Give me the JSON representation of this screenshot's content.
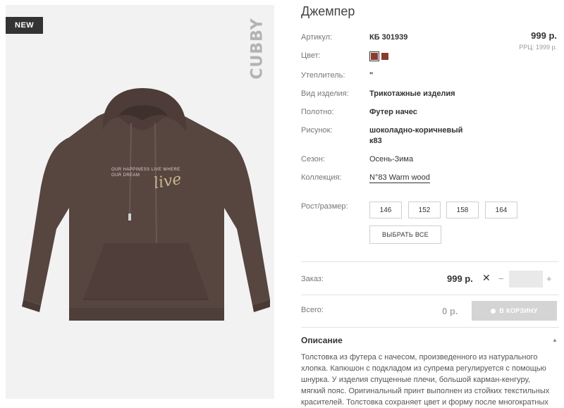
{
  "product": {
    "badge": "NEW",
    "brand": "CUBBY",
    "title": "Джемпер",
    "print_lines": [
      "OUR HAPPINESS LIVE WHERE",
      "OUR DREAM"
    ],
    "print_script": "live"
  },
  "attributes": {
    "article_label": "Артикул:",
    "article_value": "КБ 301939",
    "color_label": "Цвет:",
    "insulation_label": "Утеплитель:",
    "insulation_value": "\"",
    "type_label": "Вид изделия:",
    "type_value": "Трикотажные изделия",
    "fabric_label": "Полотно:",
    "fabric_value": "Футер начес",
    "pattern_label": "Рисунок:",
    "pattern_value_line1": "шоколадно-коричневый",
    "pattern_value_line2": "к83",
    "season_label": "Сезон:",
    "season_value": "Осень-Зима",
    "collection_label": "Коллекция:",
    "collection_value": "N°83 Warm wood",
    "size_label": "Рост/размер:"
  },
  "pricing": {
    "price": "999 р.",
    "rrp": "РРЦ: 1999 р."
  },
  "colors": [
    "#8a3a2e",
    "#8a3a2e"
  ],
  "sizes": [
    "146",
    "152",
    "158",
    "164"
  ],
  "select_all_label": "ВЫБРАТЬ ВСЕ",
  "order": {
    "order_label": "Заказ:",
    "order_price": "999 р.",
    "times": "✕",
    "minus": "−",
    "plus": "+",
    "qty_value": "",
    "total_label": "Всего:",
    "total_value": "0 р.",
    "cart_label": "В КОРЗИНУ"
  },
  "description": {
    "heading": "Описание",
    "text": "Толстовка из футера с начесом, произведенного из натурального хлопка. Капюшон с подкладом из супрема регулируется с помощью шнурка. У изделия спущенные плечи, большой карман-кенгуру, мягкий пояс. Оригинальный принт выполнен из стойких текстильных красителей. Толстовка сохраняет цвет и форму после многократных"
  }
}
